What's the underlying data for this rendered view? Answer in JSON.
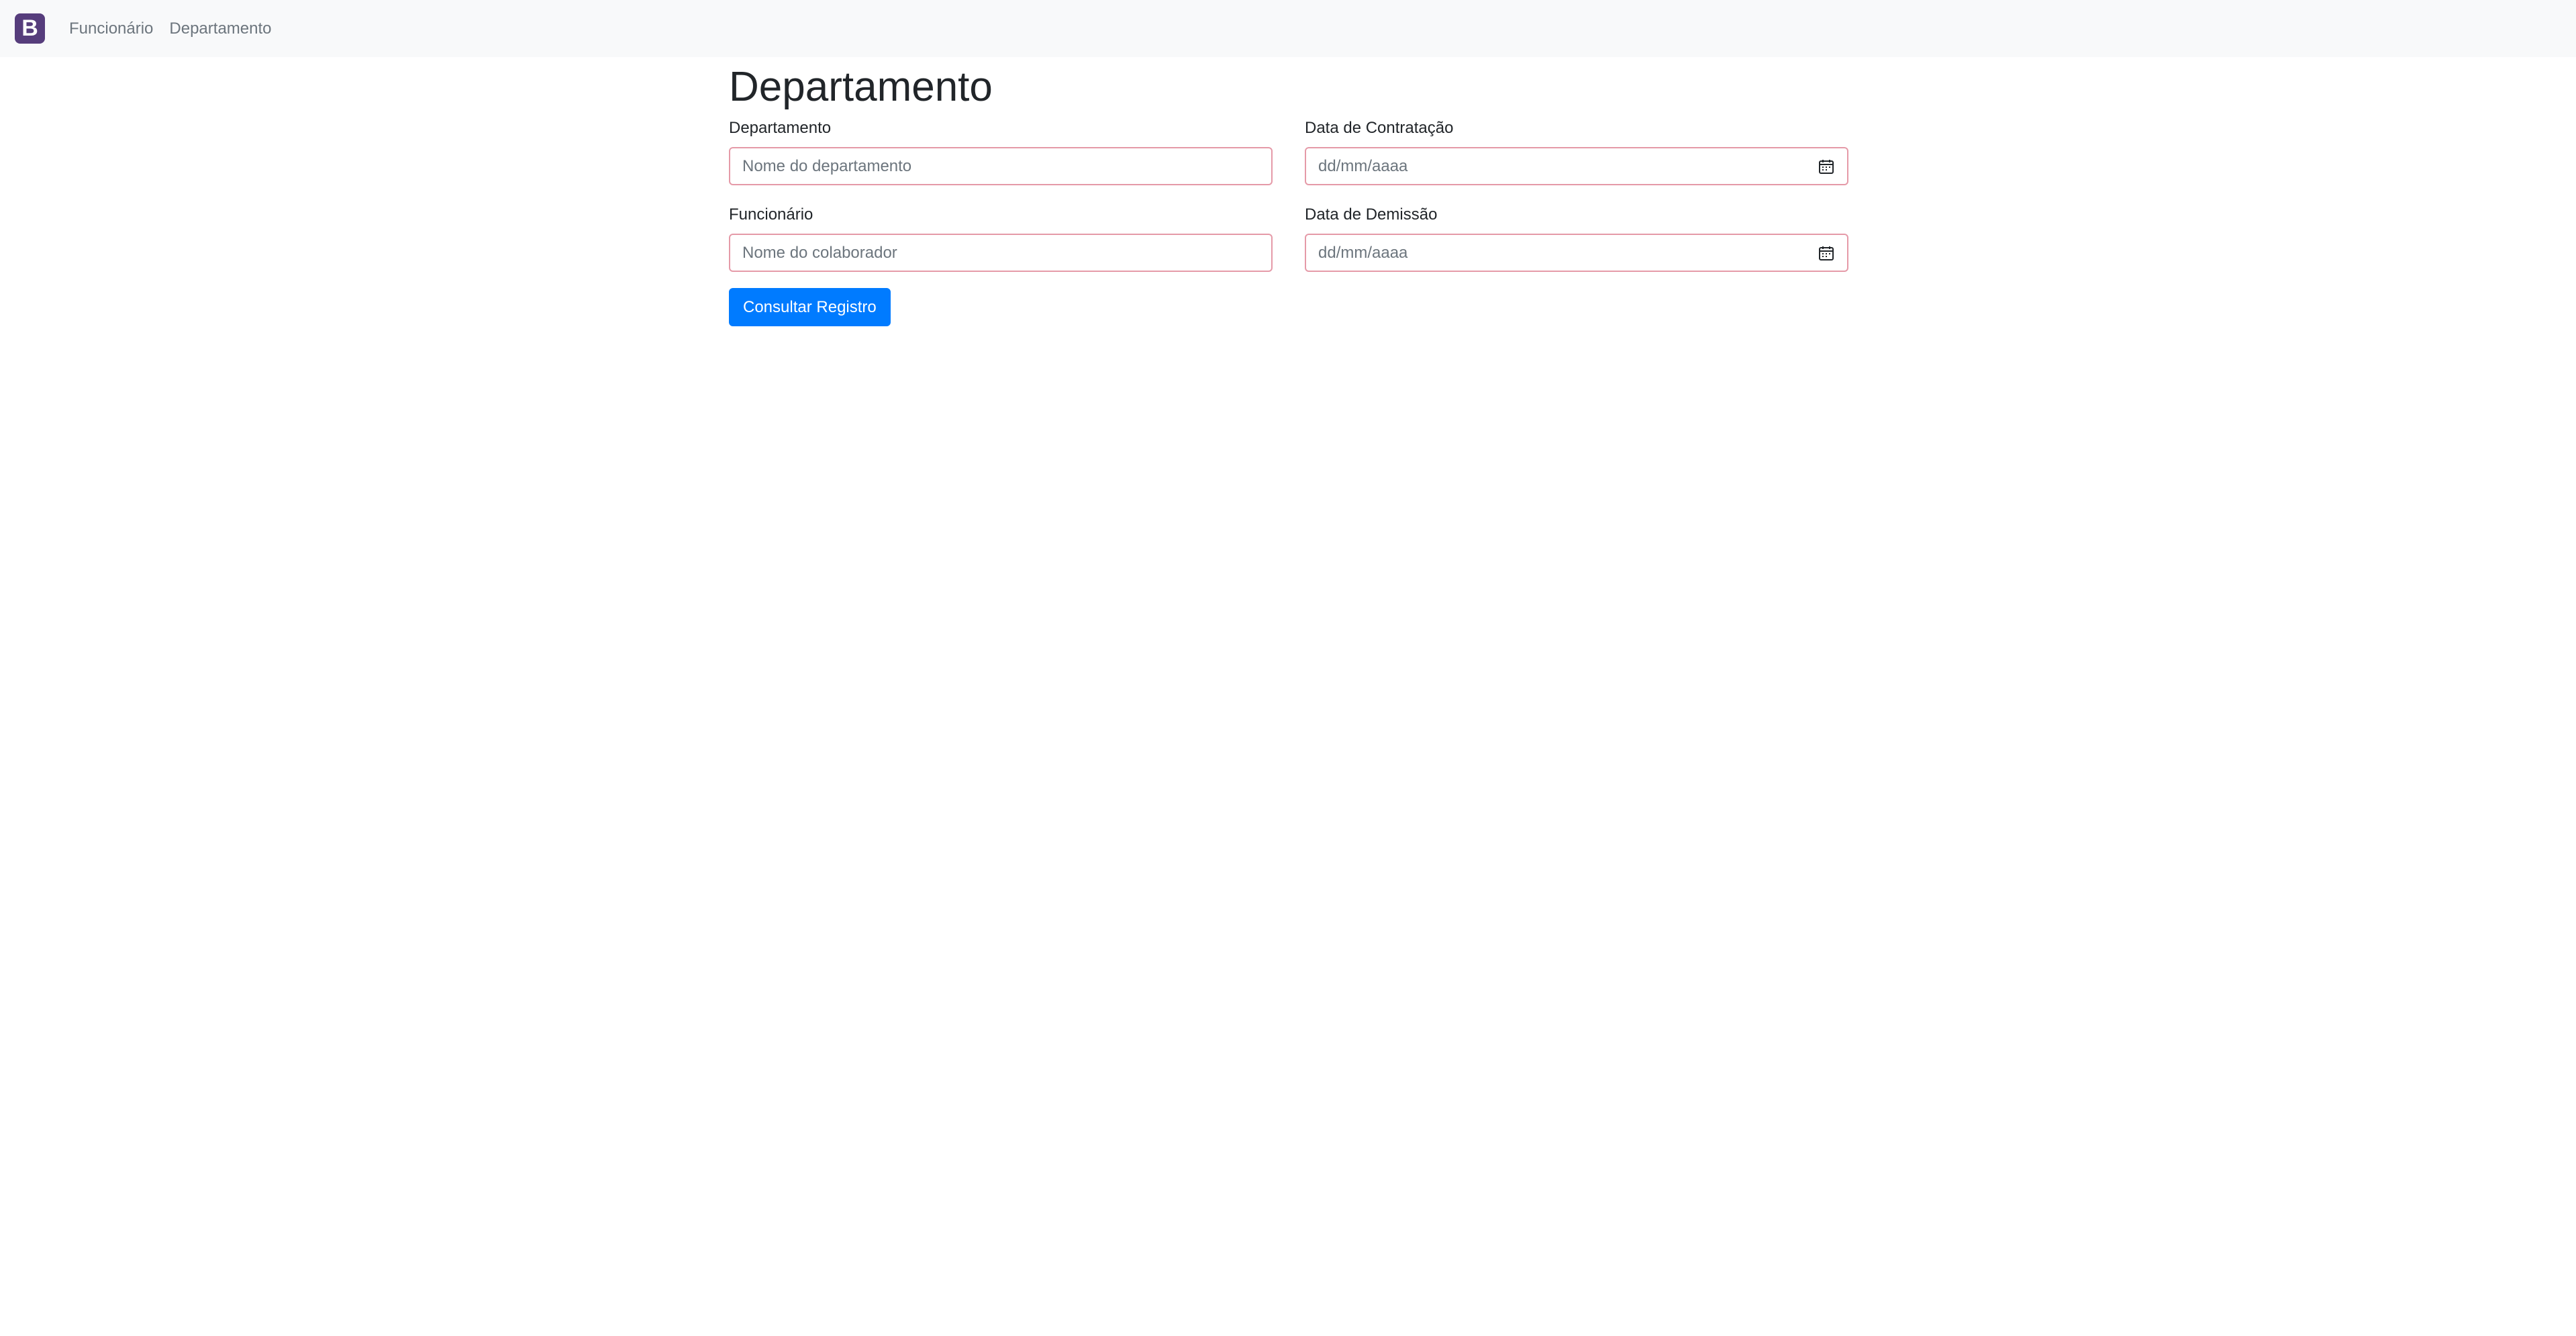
{
  "navbar": {
    "brand_letter": "B",
    "brand_color": "#563d7c",
    "links": [
      {
        "label": "Funcionário"
      },
      {
        "label": "Departamento"
      }
    ]
  },
  "page": {
    "title": "Departamento"
  },
  "form": {
    "departamento": {
      "label": "Departamento",
      "placeholder": "Nome do departamento",
      "value": ""
    },
    "data_contratacao": {
      "label": "Data de Contratação",
      "display_value": "dd/mm/aaaa",
      "icon": "calendar-icon"
    },
    "funcionario": {
      "label": "Funcionário",
      "placeholder": "Nome do colaborador",
      "value": ""
    },
    "data_demissao": {
      "label": "Data de Demissão",
      "display_value": "dd/mm/aaaa",
      "icon": "calendar-icon"
    },
    "submit_label": "Consultar Registro",
    "submit_color": "#007bff",
    "invalid_border_color": "#e59aa8"
  }
}
